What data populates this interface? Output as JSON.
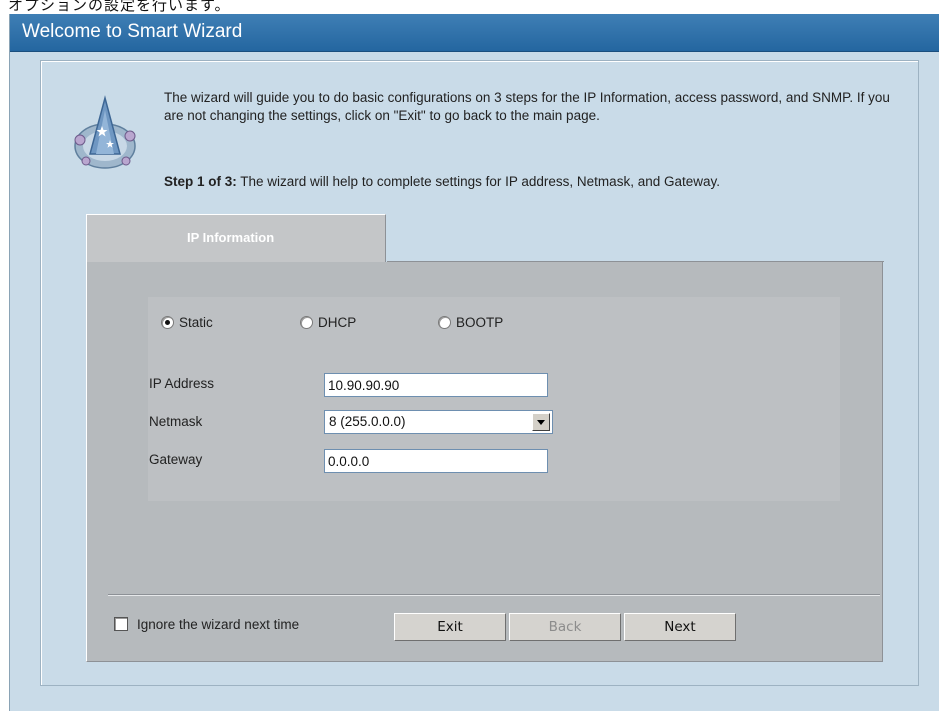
{
  "top_strip_text": "オプションの設定を行います。",
  "window": {
    "title": "Welcome to Smart Wizard"
  },
  "intro": {
    "text": "The wizard will guide you to do basic configurations on 3 steps for the IP Information, access password, and SNMP. If you are not changing the settings, click on \"Exit\" to go back to the main page.",
    "step_prefix": "Step 1 of 3:",
    "step_text": " The wizard will help to complete settings for IP address, Netmask, and Gateway."
  },
  "tab": {
    "label": "IP Information"
  },
  "mode": {
    "options": [
      "Static",
      "DHCP",
      "BOOTP"
    ],
    "selected": "Static"
  },
  "form": {
    "ip_label": "IP Address",
    "ip_value": "10.90.90.90",
    "netmask_label": "Netmask",
    "netmask_value": "8 (255.0.0.0)",
    "gateway_label": "Gateway",
    "gateway_value": "0.0.0.0"
  },
  "footer": {
    "ignore_label": "Ignore the wizard next time",
    "ignore_checked": false,
    "exit_label": "Exit",
    "back_label": "Back",
    "next_label": "Next"
  }
}
